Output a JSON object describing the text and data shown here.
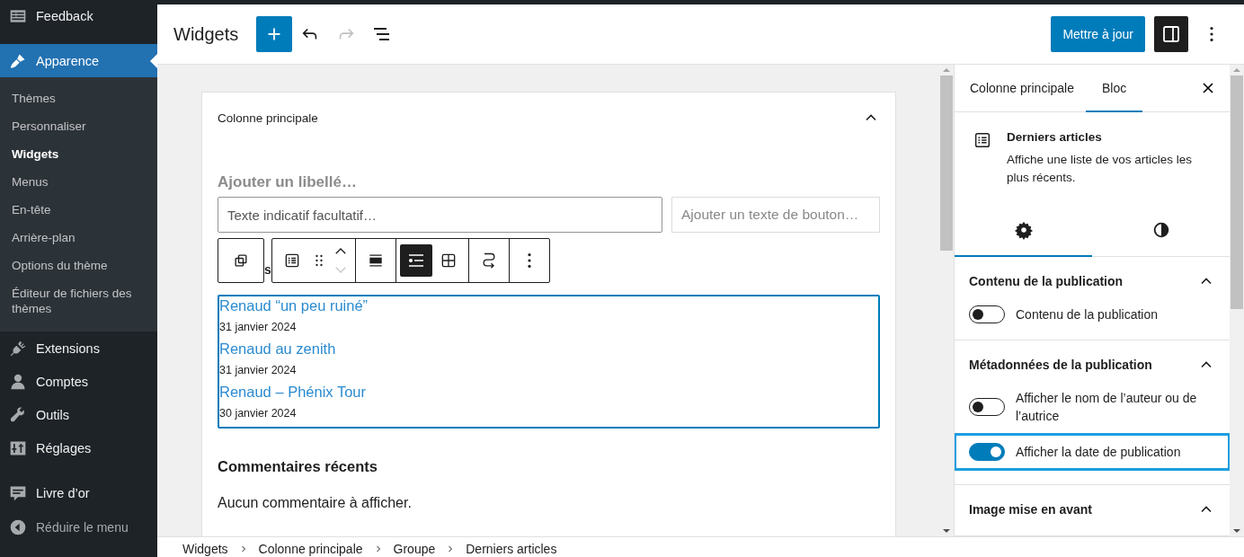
{
  "admin_menu": {
    "items": [
      {
        "kind": "feedback",
        "label": "Feedback",
        "selected": false
      },
      {
        "kind": "appearance",
        "label": "Apparence",
        "selected": true,
        "children": [
          {
            "label": "Thèmes",
            "selected": false
          },
          {
            "label": "Personnaliser",
            "selected": false
          },
          {
            "label": "Widgets",
            "selected": true
          },
          {
            "label": "Menus",
            "selected": false
          },
          {
            "label": "En-tête",
            "selected": false
          },
          {
            "label": "Arrière-plan",
            "selected": false
          },
          {
            "label": "Options du thème",
            "selected": false
          },
          {
            "label": "Éditeur de fichiers des thèmes",
            "selected": false
          }
        ]
      },
      {
        "kind": "plugins",
        "label": "Extensions",
        "selected": false
      },
      {
        "kind": "users",
        "label": "Comptes",
        "selected": false
      },
      {
        "kind": "tools",
        "label": "Outils",
        "selected": false
      },
      {
        "kind": "settings",
        "label": "Réglages",
        "selected": false
      },
      {
        "kind": "guestbook",
        "label": "Livre d’or",
        "selected": false
      },
      {
        "kind": "collapse",
        "label": "Réduire le menu",
        "selected": false
      }
    ]
  },
  "header": {
    "title": "Widgets",
    "tools": [
      {
        "kind": "add",
        "disabled": false
      },
      {
        "kind": "undo",
        "disabled": false
      },
      {
        "kind": "redo",
        "disabled": true
      },
      {
        "kind": "list_view",
        "disabled": false
      }
    ],
    "update_button": "Mettre à jour",
    "settings_toggle": {
      "selected": true
    }
  },
  "canvas": {
    "area_title": "Colonne principale",
    "expanded": true,
    "search": {
      "label_placeholder": "Ajouter un libellé…",
      "input_placeholder": "Texte indicatif facultatif…",
      "button_placeholder": "Ajouter un texte de bouton…"
    },
    "heading_fragment": "s",
    "block_toolbar": [
      {
        "kind": "parent"
      },
      {
        "kind": "block_type"
      },
      {
        "kind": "drag"
      },
      {
        "kind": "movers"
      },
      {
        "kind": "align"
      },
      {
        "kind": "list_view",
        "selected": true
      },
      {
        "kind": "grid_view",
        "selected": false
      },
      {
        "kind": "transform"
      },
      {
        "kind": "more"
      }
    ],
    "latest_posts": {
      "selected": true,
      "posts": [
        {
          "title": "Renaud “un peu ruiné”",
          "date": "31 janvier 2024"
        },
        {
          "title": "Renaud au zenith",
          "date": "31 janvier 2024"
        },
        {
          "title": "Renaud – Phénix Tour",
          "date": "30 janvier 2024"
        }
      ]
    },
    "comments_title": "Commentaires récents",
    "comments_text": "Aucun commentaire à afficher."
  },
  "inspector": {
    "tabs": [
      {
        "label": "Colonne principale",
        "selected": false
      },
      {
        "label": "Bloc",
        "selected": true
      }
    ],
    "block": {
      "title": "Derniers articles",
      "description": "Affiche une liste de vos articles les plus récents."
    },
    "subtabs": [
      {
        "kind": "settings",
        "selected": true
      },
      {
        "kind": "styles",
        "selected": false
      }
    ],
    "panels": [
      {
        "title": "Contenu de la publication",
        "expanded": true,
        "toggles": [
          {
            "label": "Contenu de la publication",
            "on": false,
            "focused": false
          }
        ]
      },
      {
        "title": "Métadonnées de la publication",
        "expanded": true,
        "toggles": [
          {
            "label": "Afficher le nom de l’auteur ou de l’autrice",
            "on": false,
            "focused": false
          },
          {
            "label": "Afficher la date de publication",
            "on": true,
            "focused": true
          }
        ]
      },
      {
        "title": "Image mise en avant",
        "expanded": true
      }
    ]
  },
  "breadcrumb": [
    "Widgets",
    "Colonne principale",
    "Groupe",
    "Derniers articles"
  ]
}
